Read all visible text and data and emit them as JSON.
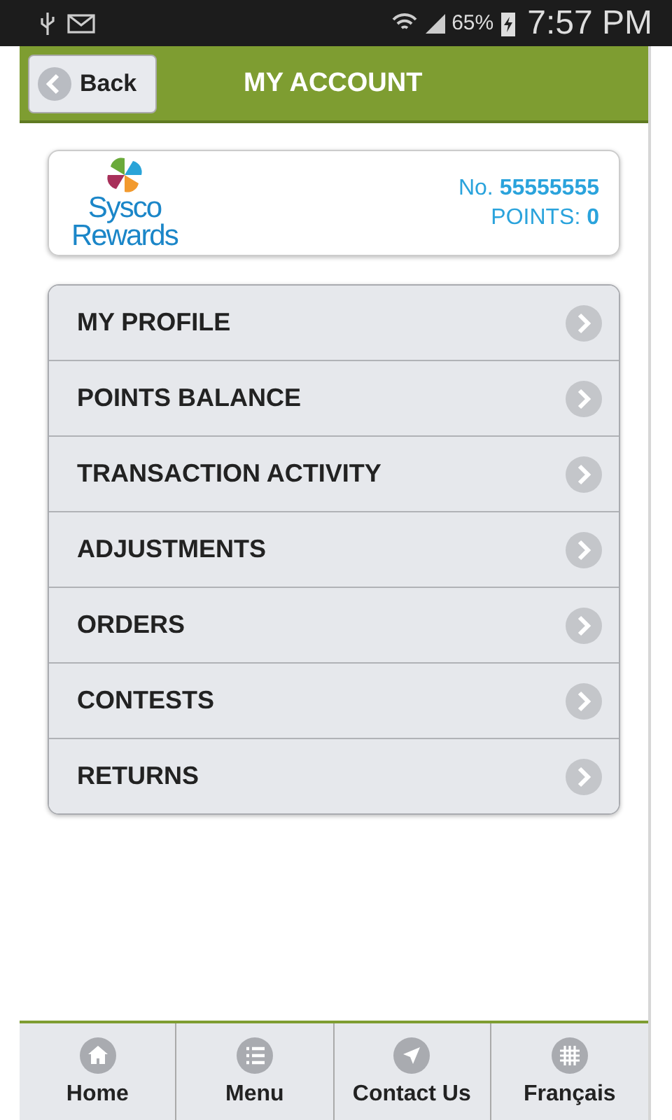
{
  "status_bar": {
    "battery": "65%",
    "time": "7:57 PM"
  },
  "header": {
    "back": "Back",
    "title": "MY ACCOUNT"
  },
  "account_card": {
    "logo_line_1": "Sysco",
    "logo_line_2": "Rewards",
    "number_label": "No.",
    "number": "55555555",
    "points_label": "POINTS:",
    "points": "0"
  },
  "menu_items": [
    {
      "label": "MY PROFILE"
    },
    {
      "label": "POINTS BALANCE"
    },
    {
      "label": "TRANSACTION ACTIVITY"
    },
    {
      "label": "ADJUSTMENTS"
    },
    {
      "label": "ORDERS"
    },
    {
      "label": "CONTESTS"
    },
    {
      "label": "RETURNS"
    }
  ],
  "bottom_nav": [
    {
      "kind": "home",
      "label": "Home"
    },
    {
      "kind": "menu",
      "label": "Menu"
    },
    {
      "kind": "contact",
      "label": "Contact Us"
    },
    {
      "kind": "language",
      "label": "Français"
    }
  ]
}
